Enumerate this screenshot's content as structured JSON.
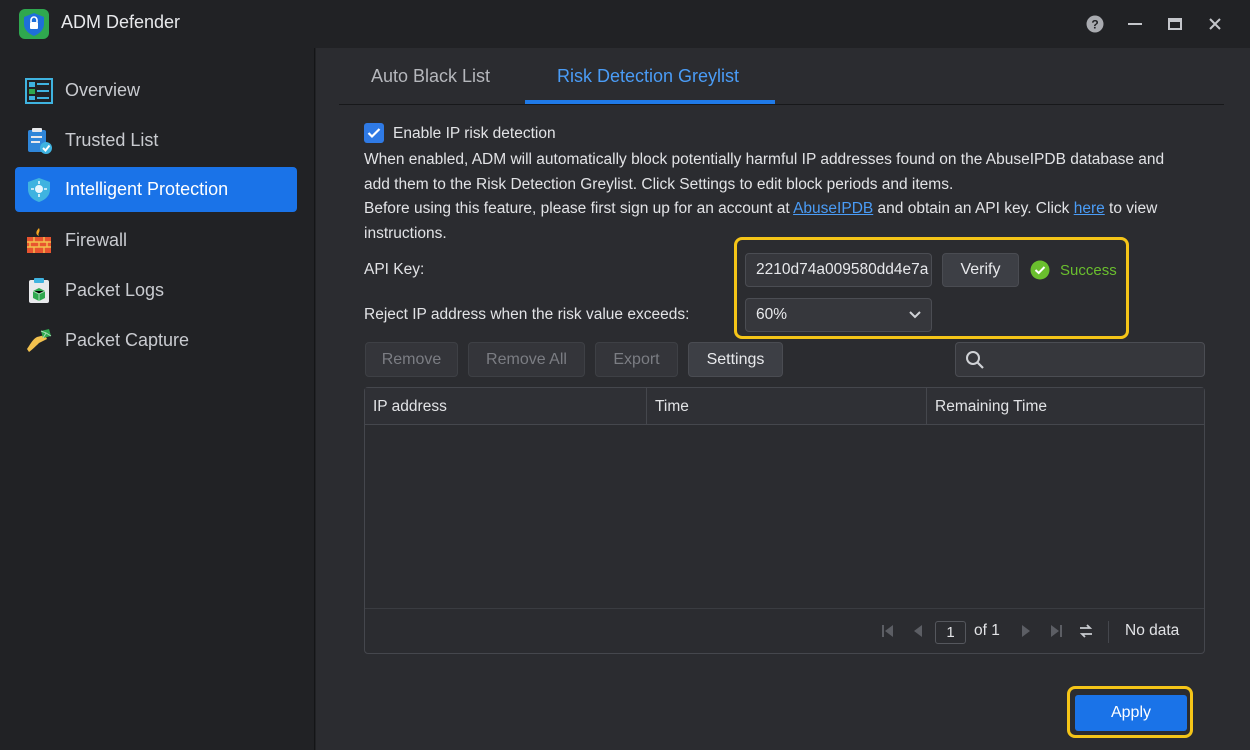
{
  "window": {
    "title": "ADM Defender"
  },
  "sidebar": {
    "items": [
      {
        "label": "Overview",
        "icon": "overview-icon"
      },
      {
        "label": "Trusted List",
        "icon": "trusted-list-icon"
      },
      {
        "label": "Intelligent Protection",
        "icon": "intelligent-protection-icon",
        "active": true
      },
      {
        "label": "Firewall",
        "icon": "firewall-icon"
      },
      {
        "label": "Packet Logs",
        "icon": "packet-logs-icon"
      },
      {
        "label": "Packet Capture",
        "icon": "packet-capture-icon"
      }
    ]
  },
  "tabs": [
    {
      "label": "Auto Black List"
    },
    {
      "label": "Risk Detection Greylist",
      "active": true
    }
  ],
  "enable": {
    "label": "Enable IP risk detection",
    "checked": true
  },
  "description": {
    "line1": "When enabled, ADM will automatically block potentially harmful IP addresses found on the AbuseIPDB database and",
    "line2": "add them to the Risk Detection Greylist. Click Settings to edit block periods and items.",
    "line3_a": "Before using this feature, please first sign up for an account at ",
    "line3_link1": "AbuseIPDB",
    "line3_b": " and obtain an API key. Click ",
    "line3_link2": "here",
    "line3_c": " to view",
    "line4": "instructions."
  },
  "api_key": {
    "label": "API Key:",
    "value": "2210d74a009580dd4e7a",
    "verify_label": "Verify",
    "status": "Success"
  },
  "reject": {
    "label": "Reject IP address when the risk value exceeds:",
    "value": "60%"
  },
  "toolbar": {
    "remove": "Remove",
    "remove_all": "Remove All",
    "export": "Export",
    "settings": "Settings",
    "search_placeholder": ""
  },
  "table": {
    "columns": [
      "IP address",
      "Time",
      "Remaining Time"
    ],
    "rows": []
  },
  "pager": {
    "page": "1",
    "of": "of 1",
    "status": "No data"
  },
  "apply_label": "Apply",
  "colors": {
    "accent": "#1a73e8",
    "highlight": "#f5c518",
    "success": "#6abf2e"
  }
}
